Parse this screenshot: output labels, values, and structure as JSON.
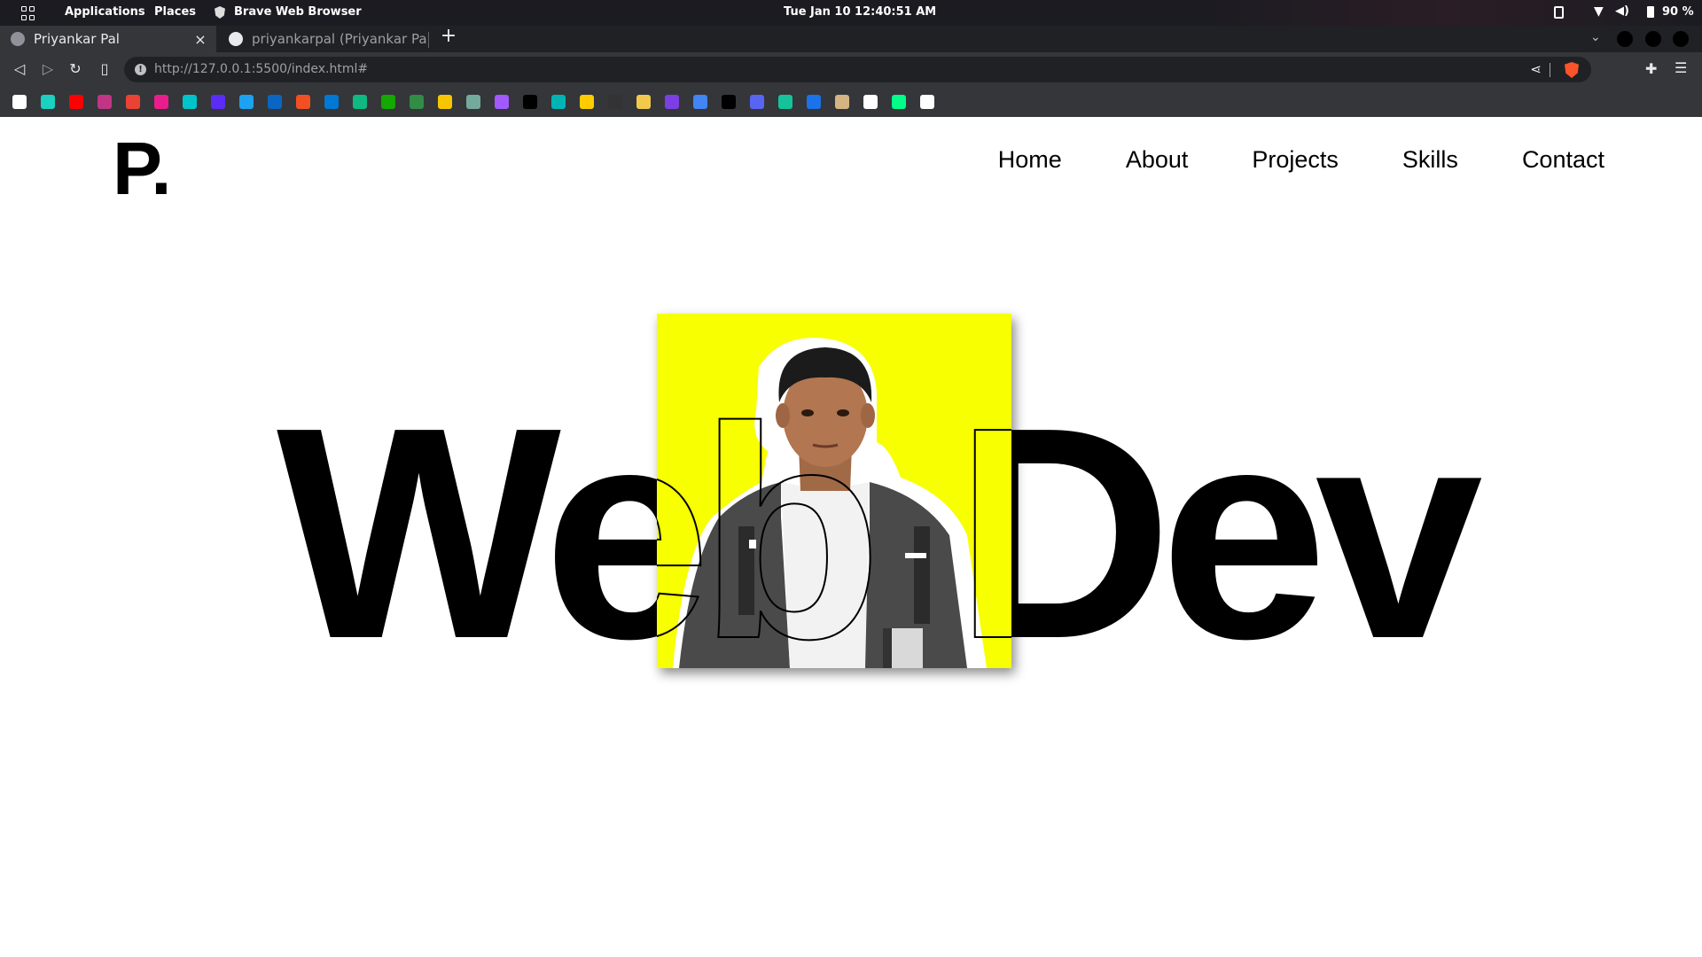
{
  "system_bar": {
    "applications": "Applications",
    "places": "Places",
    "active_app": "Brave Web Browser",
    "datetime": "Tue Jan 10  12:40:51 AM",
    "battery": "90 %"
  },
  "browser": {
    "tabs": [
      {
        "title": "Priyankar Pal",
        "active": true
      },
      {
        "title": "priyankarpal (Priyankar Pal )",
        "active": false
      }
    ],
    "new_tab": "+",
    "close_glyph": "×",
    "url_host": "http://127.0.0.1",
    "url_rest": ":5500/index.html#",
    "bookmarks": [
      {
        "icon": "github-icon",
        "color": "#ffffff"
      },
      {
        "icon": "bookmark-icon",
        "color": "#1bd1c1"
      },
      {
        "icon": "youtube-icon",
        "color": "#ff0000"
      },
      {
        "icon": "bookmark-icon",
        "color": "#c13584"
      },
      {
        "icon": "gmail-icon",
        "color": "#ea4335"
      },
      {
        "icon": "bookmark-icon",
        "color": "#e91e8c"
      },
      {
        "icon": "bookmark-icon",
        "color": "#00c4cc"
      },
      {
        "icon": "bookmark-icon",
        "color": "#5b2cf5"
      },
      {
        "icon": "twitter-icon",
        "color": "#1da1f2"
      },
      {
        "icon": "linkedin-icon",
        "color": "#0a66c2"
      },
      {
        "icon": "microsoft-icon",
        "color": "#f25022"
      },
      {
        "icon": "bookmark-icon",
        "color": "#0078d4"
      },
      {
        "icon": "bookmark-icon",
        "color": "#10b981"
      },
      {
        "icon": "upwork-icon",
        "color": "#14a800"
      },
      {
        "icon": "bookmark-icon",
        "color": "#2f8d46"
      },
      {
        "icon": "bookmark-icon",
        "color": "#f7c600"
      },
      {
        "icon": "openai-icon",
        "color": "#74aa9c"
      },
      {
        "icon": "figma-icon",
        "color": "#a259ff"
      },
      {
        "icon": "bookmark-icon",
        "color": "#000000"
      },
      {
        "icon": "bookmark-icon",
        "color": "#00b4b4"
      },
      {
        "icon": "bookmark-icon",
        "color": "#ffcc00"
      },
      {
        "icon": "bookmark-icon",
        "color": "#333333"
      },
      {
        "icon": "bookmark-icon",
        "color": "#f2c94c"
      },
      {
        "icon": "bookmark-icon",
        "color": "#7b3fe4"
      },
      {
        "icon": "bookmark-icon",
        "color": "#4285f4"
      },
      {
        "icon": "medium-icon",
        "color": "#000000"
      },
      {
        "icon": "bookmark-icon",
        "color": "#5865f2"
      },
      {
        "icon": "grammarly-icon",
        "color": "#15c39a"
      },
      {
        "icon": "bookmark-icon",
        "color": "#1a73e8"
      },
      {
        "icon": "bookmark-icon",
        "color": "#d4b483"
      },
      {
        "icon": "codepen-icon",
        "color": "#ffffff"
      },
      {
        "icon": "bookmark-icon",
        "color": "#00ff88"
      },
      {
        "icon": "codepen-icon",
        "color": "#ffffff"
      }
    ]
  },
  "site": {
    "logo": "P.",
    "nav": [
      "Home",
      "About",
      "Projects",
      "Skills",
      "Contact"
    ],
    "hero_word_1": "Web",
    "hero_word_2": "Dev",
    "photo_bg": "#f7ff00"
  }
}
